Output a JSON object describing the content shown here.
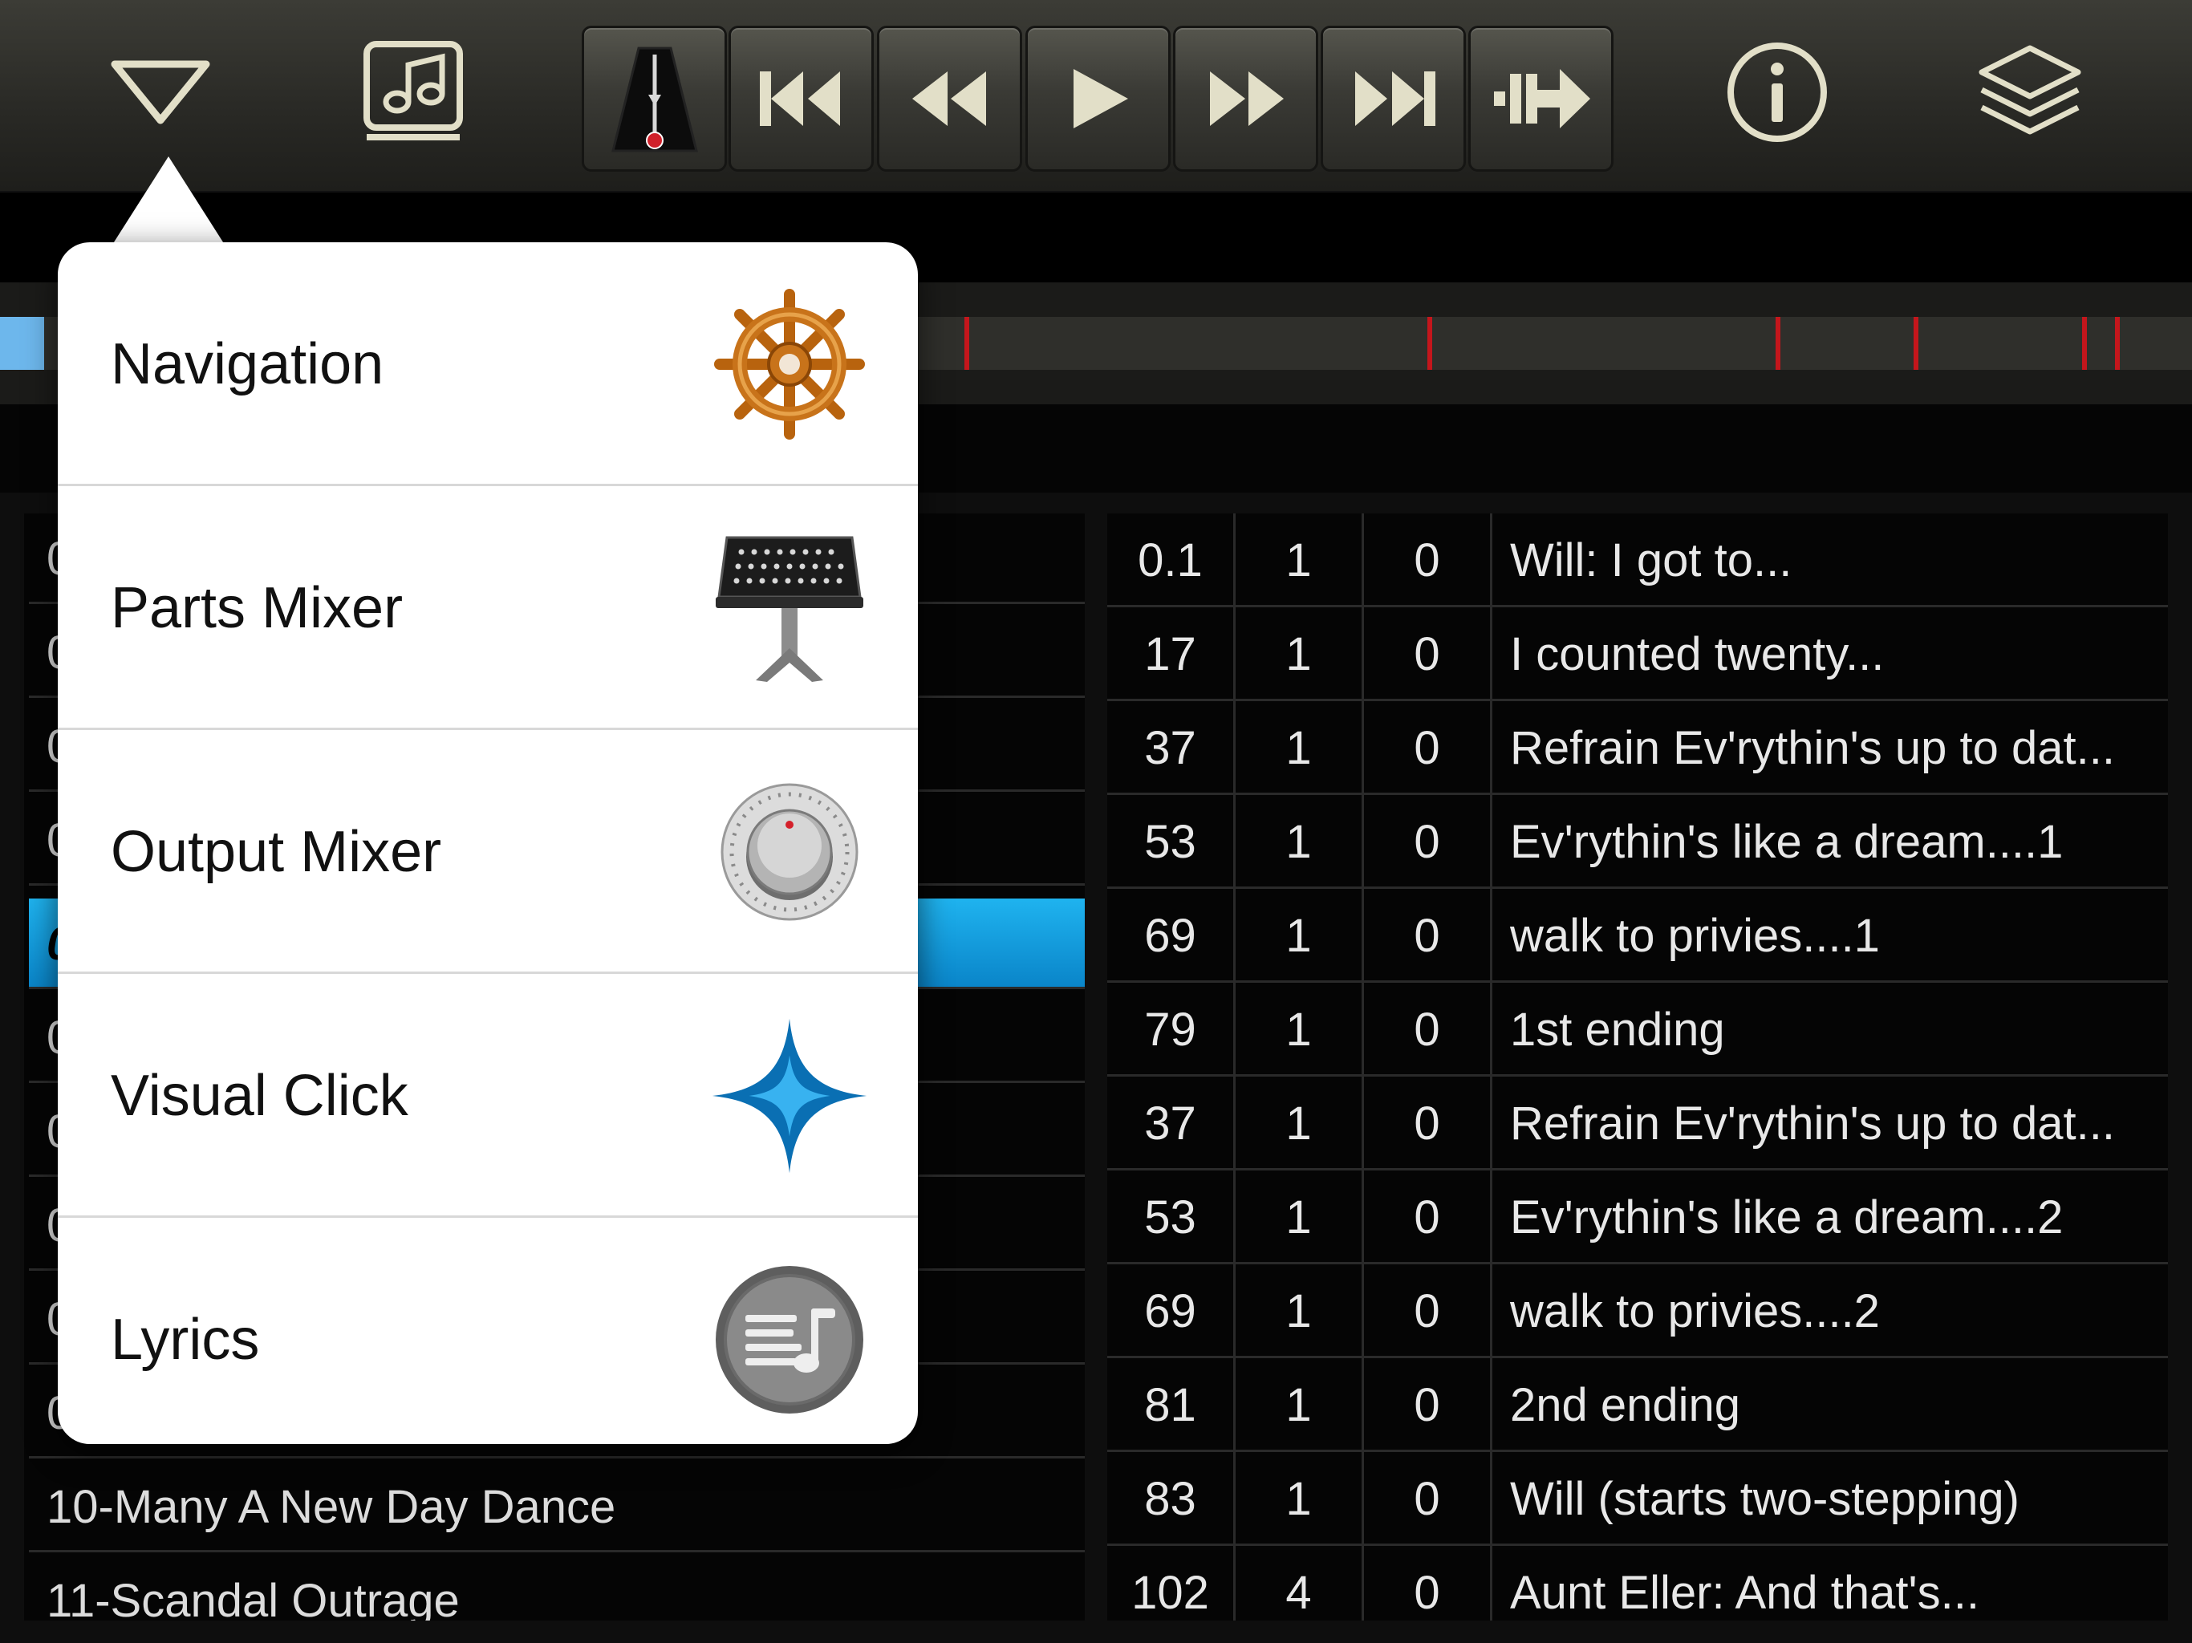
{
  "toolbar": {
    "buttons": [
      "menu-toggle",
      "song-library",
      "metronome",
      "skip-to-start",
      "rewind",
      "play",
      "fast-forward",
      "skip-to-end",
      "jump-forward",
      "info",
      "layers"
    ]
  },
  "timeline": {
    "progress_fraction": 0.02,
    "marker_fractions": [
      0.225,
      0.236,
      0.252,
      0.3,
      0.44,
      0.651,
      0.81,
      0.873,
      0.95,
      0.965
    ]
  },
  "left_list": {
    "visible_leading_chars": [
      "0",
      "0",
      "0",
      "0",
      "0",
      "0",
      "0",
      "0",
      "0",
      "0"
    ],
    "selected_index": 4,
    "rows_after_popover": [
      "10-Many A New Day Dance",
      "11-Scandal Outrage"
    ]
  },
  "right_list": {
    "rows": [
      {
        "bar": "0.1",
        "beat": "1",
        "tick": "0",
        "label": "Will: I got to..."
      },
      {
        "bar": "17",
        "beat": "1",
        "tick": "0",
        "label": "I counted twenty..."
      },
      {
        "bar": "37",
        "beat": "1",
        "tick": "0",
        "label": "Refrain Ev'rythin's up to dat..."
      },
      {
        "bar": "53",
        "beat": "1",
        "tick": "0",
        "label": "Ev'rythin's like a dream....1"
      },
      {
        "bar": "69",
        "beat": "1",
        "tick": "0",
        "label": "walk to privies....1"
      },
      {
        "bar": "79",
        "beat": "1",
        "tick": "0",
        "label": "1st ending"
      },
      {
        "bar": "37",
        "beat": "1",
        "tick": "0",
        "label": "Refrain Ev'rythin's up to dat..."
      },
      {
        "bar": "53",
        "beat": "1",
        "tick": "0",
        "label": "Ev'rythin's like a dream....2"
      },
      {
        "bar": "69",
        "beat": "1",
        "tick": "0",
        "label": "walk to privies....2"
      },
      {
        "bar": "81",
        "beat": "1",
        "tick": "0",
        "label": "2nd ending"
      },
      {
        "bar": "83",
        "beat": "1",
        "tick": "0",
        "label": "Will (starts two-stepping)"
      },
      {
        "bar": "102",
        "beat": "4",
        "tick": "0",
        "label": "Aunt Eller: And that's..."
      }
    ]
  },
  "popover": {
    "items": [
      {
        "label": "Navigation",
        "icon": "ship-wheel-icon"
      },
      {
        "label": "Parts Mixer",
        "icon": "music-stand-icon"
      },
      {
        "label": "Output Mixer",
        "icon": "volume-knob-icon"
      },
      {
        "label": "Visual Click",
        "icon": "sparkle-star-icon"
      },
      {
        "label": "Lyrics",
        "icon": "lyrics-note-icon"
      }
    ]
  },
  "colors": {
    "accent_blue": "#1fb3ef",
    "marker_red": "#c4161c",
    "toolbar_icon": "#e2dfc8"
  }
}
